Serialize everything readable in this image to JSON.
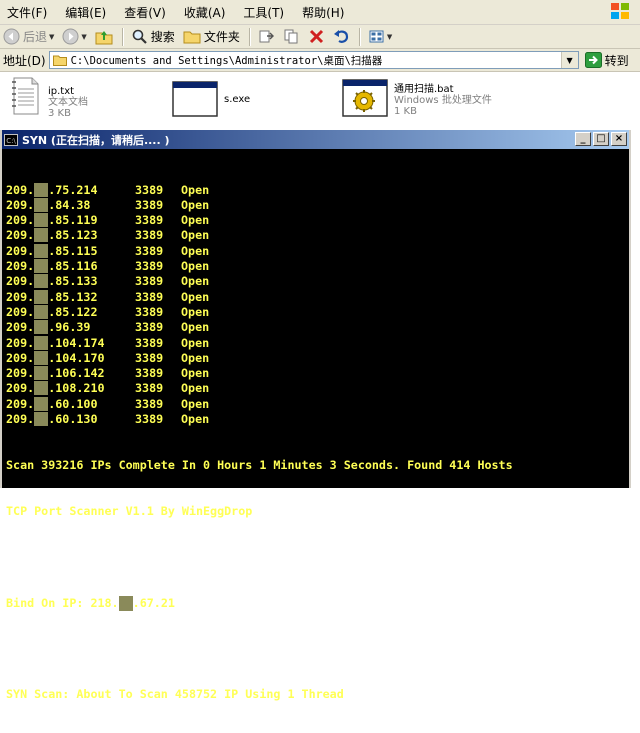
{
  "menu": {
    "items": [
      {
        "label": "文件(F)"
      },
      {
        "label": "编辑(E)"
      },
      {
        "label": "查看(V)"
      },
      {
        "label": "收藏(A)"
      },
      {
        "label": "工具(T)"
      },
      {
        "label": "帮助(H)"
      }
    ]
  },
  "toolbar": {
    "back_label": "后退",
    "search_label": "搜索",
    "folders_label": "文件夹"
  },
  "address": {
    "label": "地址(D)",
    "path": "C:\\Documents and Settings\\Administrator\\桌面\\扫描器",
    "go_label": "转到"
  },
  "files": [
    {
      "name": "ip.txt",
      "type": "文本文档",
      "size": "3 KB",
      "icon": "text-file-icon"
    },
    {
      "name": "s.exe",
      "type": "",
      "size": "",
      "icon": "exe-window-icon"
    },
    {
      "name": "通用扫描.bat",
      "type": "Windows 批处理文件",
      "size": "1 KB",
      "icon": "batch-file-icon"
    }
  ],
  "console": {
    "title": "SYN (正在扫描，请稍后.... )",
    "results": [
      {
        "ip_prefix": "209.",
        "ip_suffix": ".75.214",
        "port": "3389",
        "status": "Open"
      },
      {
        "ip_prefix": "209.",
        "ip_suffix": ".84.38",
        "port": "3389",
        "status": "Open"
      },
      {
        "ip_prefix": "209.",
        "ip_suffix": ".85.119",
        "port": "3389",
        "status": "Open"
      },
      {
        "ip_prefix": "209.",
        "ip_suffix": ".85.123",
        "port": "3389",
        "status": "Open"
      },
      {
        "ip_prefix": "209.",
        "ip_suffix": ".85.115",
        "port": "3389",
        "status": "Open"
      },
      {
        "ip_prefix": "209.",
        "ip_suffix": ".85.116",
        "port": "3389",
        "status": "Open"
      },
      {
        "ip_prefix": "209.",
        "ip_suffix": ".85.133",
        "port": "3389",
        "status": "Open"
      },
      {
        "ip_prefix": "209.",
        "ip_suffix": ".85.132",
        "port": "3389",
        "status": "Open"
      },
      {
        "ip_prefix": "209.",
        "ip_suffix": ".85.122",
        "port": "3389",
        "status": "Open"
      },
      {
        "ip_prefix": "209.",
        "ip_suffix": ".96.39",
        "port": "3389",
        "status": "Open"
      },
      {
        "ip_prefix": "209.",
        "ip_suffix": ".104.174",
        "port": "3389",
        "status": "Open"
      },
      {
        "ip_prefix": "209.",
        "ip_suffix": ".104.170",
        "port": "3389",
        "status": "Open"
      },
      {
        "ip_prefix": "209.",
        "ip_suffix": ".106.142",
        "port": "3389",
        "status": "Open"
      },
      {
        "ip_prefix": "209.",
        "ip_suffix": ".108.210",
        "port": "3389",
        "status": "Open"
      },
      {
        "ip_prefix": "209.",
        "ip_suffix": ".60.100",
        "port": "3389",
        "status": "Open"
      },
      {
        "ip_prefix": "209.",
        "ip_suffix": ".60.130",
        "port": "3389",
        "status": "Open"
      }
    ],
    "summary": "Scan 393216 IPs Complete In 0 Hours 1 Minutes 3 Seconds. Found 414 Hosts",
    "banner": "TCP Port Scanner V1.1 By WinEggDrop",
    "bind_prefix": "Bind On IP: 218.",
    "bind_suffix": ".67.21",
    "syn_line": "SYN Scan: About To Scan 458752 IP Using 1 Thread"
  },
  "colors": {
    "console_text": "#ffff55",
    "console_bg": "#000000",
    "chrome": "#ece9d8",
    "titlebar": "#0a246a"
  }
}
